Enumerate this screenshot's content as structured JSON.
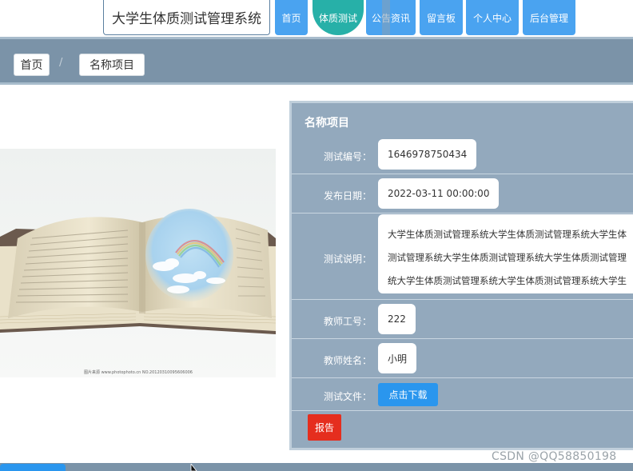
{
  "header": {
    "site_title": "大学生体质测试管理系统",
    "nav": [
      {
        "label": "首页"
      },
      {
        "label": "体质测试",
        "active": true
      },
      {
        "label": "公告资讯"
      },
      {
        "label": "留言板"
      },
      {
        "label": "个人中心"
      },
      {
        "label": "后台管理"
      }
    ]
  },
  "breadcrumb": {
    "home": "首页",
    "separator": "/",
    "current": "名称项目"
  },
  "detail": {
    "title": "名称项目",
    "fields": {
      "test_id": {
        "label": "测试编号：",
        "value": "1646978750434"
      },
      "publish_date": {
        "label": "发布日期：",
        "value": "2022-03-11 00:00:00"
      },
      "description": {
        "label": "测试说明：",
        "lines": [
          "大学生体质测试管理系统大学生体质测试管理系统大学生体",
          "测试管理系统大学生体质测试管理系统大学生体质测试管理",
          "统大学生体质测试管理系统大学生体质测试管理系统大学生"
        ]
      },
      "teacher_id": {
        "label": "教师工号：",
        "value": "222"
      },
      "teacher_name": {
        "label": "教师姓名：",
        "value": "小明"
      },
      "test_file": {
        "label": "测试文件：",
        "button": "点击下载"
      }
    },
    "report_button": "报告"
  },
  "image": {
    "caption": "图片来源 www.photophoto.cn NO.20120310095606006"
  },
  "watermark": "CSDN @QQ58850198",
  "colors": {
    "nav_blue": "#4aa3f0",
    "nav_active": "#27b0a8",
    "bar_slate": "#7b93a8",
    "panel": "#93a9bd",
    "download": "#2a96ee",
    "report": "#e52e1e"
  }
}
